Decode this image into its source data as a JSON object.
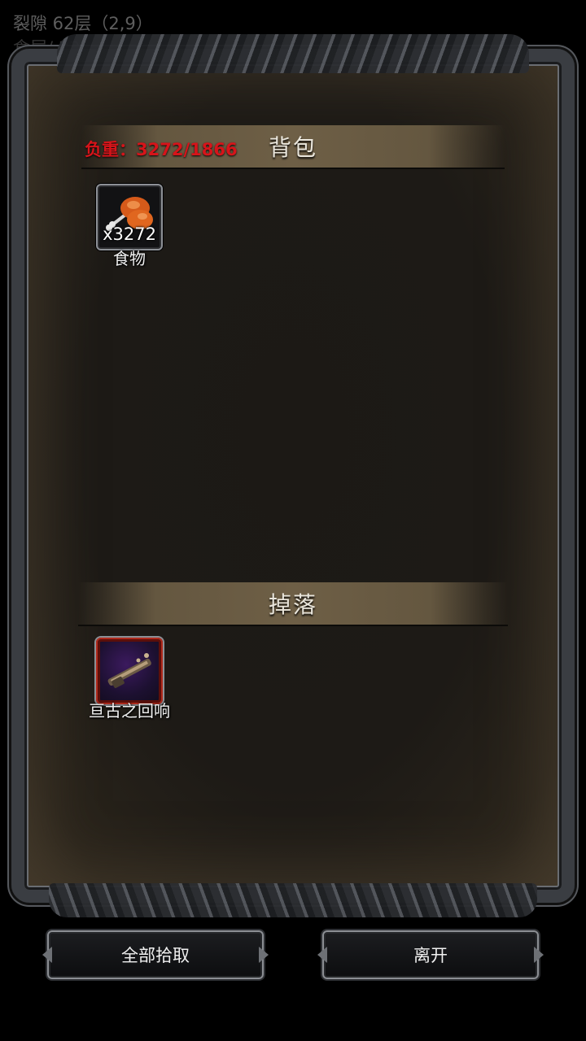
{
  "hud": {
    "location": "裂隙 62层（2,9）",
    "second_line": "食层/  32"
  },
  "backpack": {
    "title": "背包",
    "weight": "负重：3272/1866",
    "items": [
      {
        "name": "食物",
        "quantity": "x3272",
        "icon": "drumstick-icon"
      }
    ]
  },
  "drops": {
    "title": "掉落",
    "items": [
      {
        "name": "亘古之回响",
        "icon": "rifle-icon"
      }
    ]
  },
  "buttons": {
    "pick_all": "全部拾取",
    "leave": "离开"
  }
}
